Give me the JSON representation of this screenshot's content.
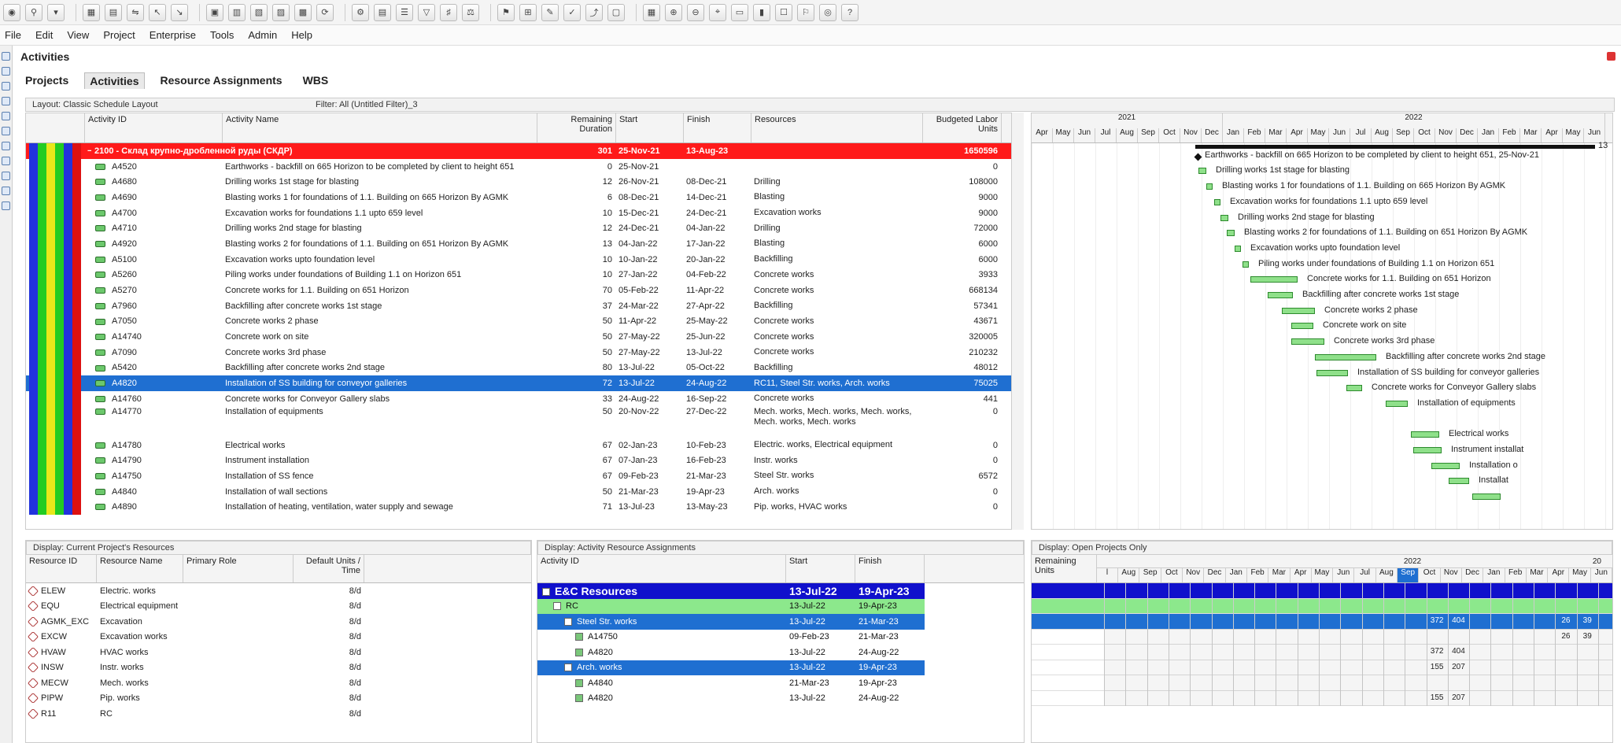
{
  "menu": [
    "File",
    "Edit",
    "View",
    "Project",
    "Enterprise",
    "Tools",
    "Admin",
    "Help"
  ],
  "title": "Activities",
  "tabs": [
    {
      "label": "Projects",
      "active": false
    },
    {
      "label": "Activities",
      "active": true
    },
    {
      "label": "Resource Assignments",
      "active": false
    },
    {
      "label": "WBS",
      "active": false
    }
  ],
  "layout_bar": {
    "layout": "Layout: Classic Schedule Layout",
    "filter": "Filter: All (Untitled Filter)_3"
  },
  "activity_columns": [
    "Activity ID",
    "Activity Name",
    "Remaining Duration",
    "Start",
    "Finish",
    "Resources",
    "Budgeted Labor Units"
  ],
  "wbs_row": {
    "id": "2100 - Склад крупно-дробленной руды (СКДР)",
    "duration": "301",
    "start": "25-Nov-21",
    "finish": "13-Aug-23",
    "units": "1650596"
  },
  "activities": [
    {
      "id": "A4520",
      "name": "Earthworks - backfill on 665 Horizon to be completed by client to height 651",
      "dur": "0",
      "start": "25-Nov-21",
      "finish": "",
      "res": "",
      "units": "0",
      "selected": false
    },
    {
      "id": "A4680",
      "name": "Drilling works 1st stage for blasting",
      "dur": "12",
      "start": "26-Nov-21",
      "finish": "08-Dec-21",
      "res": "Drilling",
      "units": "108000",
      "selected": false
    },
    {
      "id": "A4690",
      "name": "Blasting works 1 for foundations of 1.1. Building on 665 Horizon By AGMK",
      "dur": "6",
      "start": "08-Dec-21",
      "finish": "14-Dec-21",
      "res": "Blasting",
      "units": "9000",
      "selected": false
    },
    {
      "id": "A4700",
      "name": "Excavation works for foundations 1.1 upto 659 level",
      "dur": "10",
      "start": "15-Dec-21",
      "finish": "24-Dec-21",
      "res": "Excavation works",
      "units": "9000",
      "selected": false
    },
    {
      "id": "A4710",
      "name": "Drilling works 2nd stage for blasting",
      "dur": "12",
      "start": "24-Dec-21",
      "finish": "04-Jan-22",
      "res": "Drilling",
      "units": "72000",
      "selected": false
    },
    {
      "id": "A4920",
      "name": "Blasting works 2 for foundations of 1.1. Building on 651 Horizon By AGMK",
      "dur": "13",
      "start": "04-Jan-22",
      "finish": "17-Jan-22",
      "res": "Blasting",
      "units": "6000",
      "selected": false
    },
    {
      "id": "A5100",
      "name": "Excavation works upto foundation level",
      "dur": "10",
      "start": "10-Jan-22",
      "finish": "20-Jan-22",
      "res": "Backfilling",
      "units": "6000",
      "selected": false
    },
    {
      "id": "A5260",
      "name": "Piling works under foundations of Building 1.1 on Horizon 651",
      "dur": "10",
      "start": "27-Jan-22",
      "finish": "04-Feb-22",
      "res": "Concrete works",
      "units": "3933",
      "selected": false
    },
    {
      "id": "A5270",
      "name": "Concrete works for 1.1. Building on 651 Horizon",
      "dur": "70",
      "start": "05-Feb-22",
      "finish": "11-Apr-22",
      "res": "Concrete works",
      "units": "668134",
      "selected": false
    },
    {
      "id": "A7960",
      "name": "Backfilling after concrete works 1st stage",
      "dur": "37",
      "start": "24-Mar-22",
      "finish": "27-Apr-22",
      "res": "Backfilling",
      "units": "57341",
      "selected": false
    },
    {
      "id": "A7050",
      "name": "Concrete works 2 phase",
      "dur": "50",
      "start": "11-Apr-22",
      "finish": "25-May-22",
      "res": "Concrete works",
      "units": "43671",
      "selected": false
    },
    {
      "id": "A14740",
      "name": "Concrete work on site",
      "dur": "50",
      "start": "27-May-22",
      "finish": "25-Jun-22",
      "res": "Concrete works",
      "units": "320005",
      "selected": false
    },
    {
      "id": "A7090",
      "name": "Concrete works 3rd phase",
      "dur": "50",
      "start": "27-May-22",
      "finish": "13-Jul-22",
      "res": "Concrete works",
      "units": "210232",
      "selected": false
    },
    {
      "id": "A5420",
      "name": "Backfilling after concrete works 2nd stage",
      "dur": "80",
      "start": "13-Jul-22",
      "finish": "05-Oct-22",
      "res": "Backfilling",
      "units": "48012",
      "selected": false
    },
    {
      "id": "A4820",
      "name": "Installation of SS building for conveyor galleries",
      "dur": "72",
      "start": "13-Jul-22",
      "finish": "24-Aug-22",
      "res": "RC11, Steel Str. works, Arch. works",
      "units": "75025",
      "selected": true
    },
    {
      "id": "A14760",
      "name": "Concrete works for Conveyor Gallery slabs",
      "dur": "33",
      "start": "24-Aug-22",
      "finish": "16-Sep-22",
      "res": "Concrete works",
      "units": "441",
      "selected": false
    },
    {
      "id": "A14770",
      "name": "Installation of equipments",
      "dur": "50",
      "start": "20-Nov-22",
      "finish": "27-Dec-22",
      "res": "Mech. works, Mech. works, Mech. works, Mech. works, Mech. works",
      "units": "0",
      "selected": false
    },
    {
      "id": "A14780",
      "name": "Electrical works",
      "dur": "67",
      "start": "02-Jan-23",
      "finish": "10-Feb-23",
      "res": "Electric. works, Electrical equipment",
      "units": "0",
      "selected": false
    },
    {
      "id": "A14790",
      "name": "Instrument installation",
      "dur": "67",
      "start": "07-Jan-23",
      "finish": "16-Feb-23",
      "res": "Instr. works",
      "units": "0",
      "selected": false
    },
    {
      "id": "A14750",
      "name": "Installation of SS fence",
      "dur": "67",
      "start": "09-Feb-23",
      "finish": "21-Mar-23",
      "res": "Steel Str. works",
      "units": "6572",
      "selected": false
    },
    {
      "id": "A4840",
      "name": "Installation of wall sections",
      "dur": "50",
      "start": "21-Mar-23",
      "finish": "19-Apr-23",
      "res": "Arch. works",
      "units": "0",
      "selected": false
    },
    {
      "id": "A4890",
      "name": "Installation of heating, ventilation, water supply and sewage",
      "dur": "71",
      "start": "13-Jul-23",
      "finish": "13-May-23",
      "res": "Pip. works, HVAC works",
      "units": "0",
      "selected": false
    }
  ],
  "gantt": {
    "years": [
      "2021",
      "2022"
    ],
    "months": [
      "Apr",
      "May",
      "Jun",
      "Jul",
      "Aug",
      "Sep",
      "Oct",
      "Nov",
      "Dec",
      "Jan",
      "Feb",
      "Mar",
      "Apr",
      "May",
      "Jun",
      "Jul",
      "Aug",
      "Sep",
      "Oct",
      "Nov",
      "Dec",
      "Jan",
      "Feb",
      "Mar",
      "Apr",
      "May",
      "Jun"
    ],
    "summary_label": "13",
    "labels": [
      "Earthworks - backfill on 665 Horizon to be completed by client to height 651, 25-Nov-21",
      "Drilling works 1st stage for blasting",
      "Blasting works 1 for foundations of 1.1. Building on 665 Horizon By AGMK",
      "Excavation works for foundations 1.1 upto 659 level",
      "Drilling works 2nd stage for blasting",
      "Blasting works 2 for foundations of 1.1. Building on 651 Horizon By AGMK",
      "Excavation works upto foundation level",
      "Piling works under foundations of Building 1.1 on Horizon 651",
      "Concrete works for 1.1. Building on 651 Horizon",
      "Backfilling after concrete works 1st stage",
      "Concrete works 2 phase",
      "Concrete work on site",
      "Concrete works 3rd phase",
      "Backfilling after concrete works 2nd stage",
      "Installation of SS building for conveyor galleries",
      "Concrete works for Conveyor Gallery slabs",
      "Installation of equipments",
      "Electrical works",
      "Instrument installat",
      "Installation o",
      "Installat",
      ""
    ]
  },
  "resources_panel": {
    "header": "Display: Current Project's Resources",
    "columns": [
      "Resource ID",
      "Resource Name",
      "Primary Role",
      "Default Units / Time"
    ],
    "rows": [
      {
        "id": "ELEW",
        "name": "Electric. works",
        "role": "",
        "units": "8/d"
      },
      {
        "id": "EQU",
        "name": "Electrical equipment",
        "role": "",
        "units": "8/d"
      },
      {
        "id": "AGMK_EXC",
        "name": "Excavation",
        "role": "",
        "units": "8/d"
      },
      {
        "id": "EXCW",
        "name": "Excavation works",
        "role": "",
        "units": "8/d"
      },
      {
        "id": "HVAW",
        "name": "HVAC works",
        "role": "",
        "units": "8/d"
      },
      {
        "id": "INSW",
        "name": "Instr. works",
        "role": "",
        "units": "8/d"
      },
      {
        "id": "MECW",
        "name": "Mech. works",
        "role": "",
        "units": "8/d"
      },
      {
        "id": "PIPW",
        "name": "Pip. works",
        "role": "",
        "units": "8/d"
      },
      {
        "id": "R11",
        "name": "RC",
        "role": "",
        "units": "8/d"
      }
    ]
  },
  "assignments_panel": {
    "header": "Display: Activity Resource Assignments",
    "columns": [
      "Activity ID",
      "Start",
      "Finish"
    ],
    "rows": [
      {
        "label": "E&C Resources",
        "start": "13-Jul-22",
        "finish": "19-Apr-23",
        "level": 0
      },
      {
        "label": "RC",
        "start": "13-Jul-22",
        "finish": "19-Apr-23",
        "level": 1
      },
      {
        "label": "Steel Str. works",
        "start": "13-Jul-22",
        "finish": "21-Mar-23",
        "level": 2
      },
      {
        "label": "A14750",
        "start": "09-Feb-23",
        "finish": "21-Mar-23",
        "level": 3
      },
      {
        "label": "A4820",
        "start": "13-Jul-22",
        "finish": "24-Aug-22",
        "level": 3
      },
      {
        "label": "Arch. works",
        "start": "13-Jul-22",
        "finish": "19-Apr-23",
        "level": 2
      },
      {
        "label": "A4840",
        "start": "21-Mar-23",
        "finish": "19-Apr-23",
        "level": 3
      },
      {
        "label": "A4820",
        "start": "13-Jul-22",
        "finish": "24-Aug-22",
        "level": 3
      }
    ]
  },
  "usage_panel": {
    "header": "Display: Open Projects Only",
    "col": "Remaining Units",
    "year": "2022",
    "year2": "20",
    "months": [
      "l",
      "Aug",
      "Sep",
      "Oct",
      "Nov",
      "Dec",
      "Jan",
      "Feb",
      "Mar",
      "Apr",
      "May",
      "Jun",
      "Jul",
      "Aug",
      "Sep",
      "Oct",
      "Nov",
      "Dec",
      "Jan",
      "Feb",
      "Mar",
      "Apr",
      "May",
      "Jun"
    ],
    "values": [
      {
        "row": 2,
        "col": 15,
        "v": "372"
      },
      {
        "row": 2,
        "col": 16,
        "v": "404"
      },
      {
        "row": 2,
        "col": 21,
        "v": "26"
      },
      {
        "row": 2,
        "col": 22,
        "v": "39"
      },
      {
        "row": 3,
        "col": 21,
        "v": "26"
      },
      {
        "row": 3,
        "col": 22,
        "v": "39"
      },
      {
        "row": 4,
        "col": 15,
        "v": "372"
      },
      {
        "row": 4,
        "col": 16,
        "v": "404"
      },
      {
        "row": 5,
        "col": 15,
        "v": "155"
      },
      {
        "row": 5,
        "col": 16,
        "v": "207"
      },
      {
        "row": 7,
        "col": 15,
        "v": "155"
      },
      {
        "row": 7,
        "col": 16,
        "v": "207"
      }
    ]
  }
}
